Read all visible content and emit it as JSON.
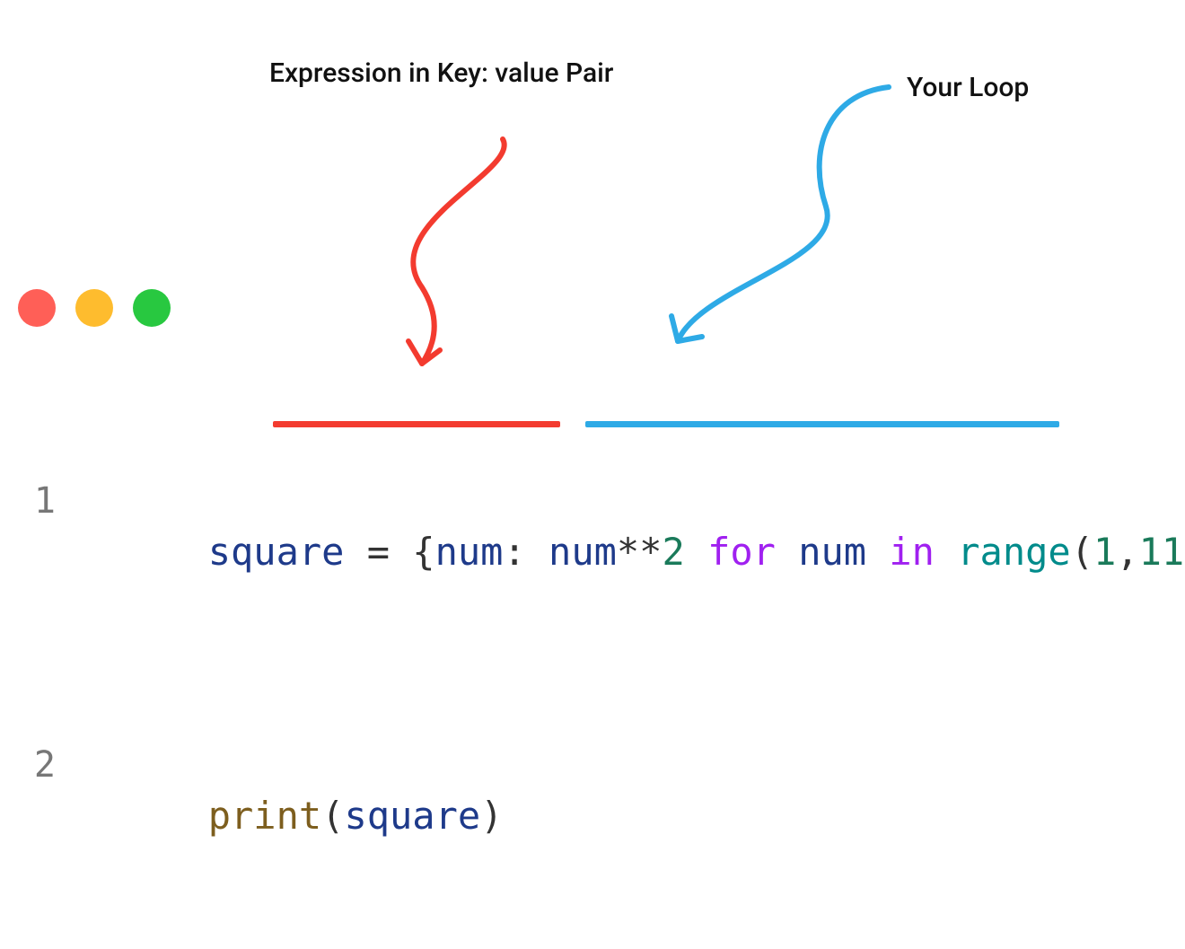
{
  "labels": {
    "expression": "Expression in Key: value Pair",
    "loop": "Your Loop"
  },
  "code": {
    "line1": {
      "ln": "1",
      "var": "square",
      "eq": " = ",
      "lbrace": "{",
      "key": "num",
      "colon": ": ",
      "val1": "num",
      "op": "**",
      "two": "2",
      "sp1": " ",
      "for": "for",
      "sp2": " ",
      "iter": "num",
      "sp3": " ",
      "in": "in",
      "sp4": " ",
      "range": "range",
      "lparen": "(",
      "one": "1",
      "comma": ",",
      "eleven": "11",
      "rparen": ")",
      "rbrace": "}"
    },
    "line2": {
      "ln": "2",
      "print": "print",
      "lparen": "(",
      "arg": "square",
      "rparen": ")"
    }
  },
  "colors": {
    "arrow_red": "#f33b2f",
    "arrow_blue": "#2eaae6"
  }
}
